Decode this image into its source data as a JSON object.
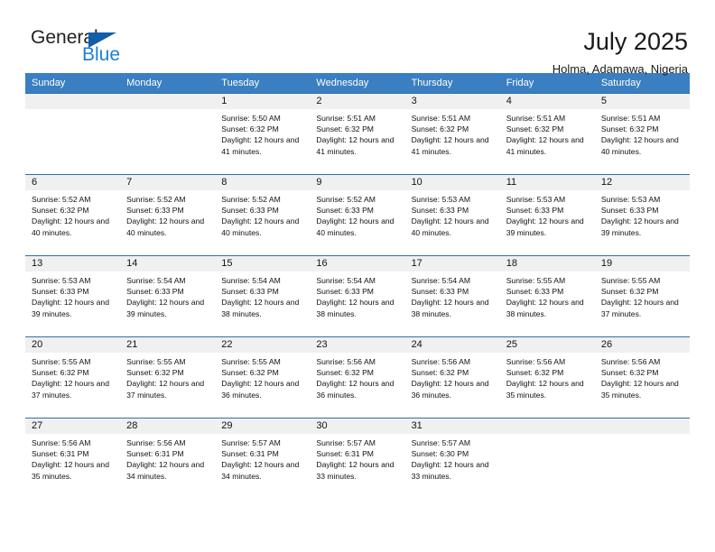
{
  "brand": {
    "name_top": "General",
    "name_bottom": "Blue",
    "triangle_color": "#125ea8",
    "blue_color": "#1c7fd4"
  },
  "header": {
    "title": "July 2025",
    "subtitle": "Holma, Adamawa, Nigeria"
  },
  "theme": {
    "header_row_bg": "#3a7fc1",
    "daynum_bg": "#f0f0f0",
    "row_border": "#2f6fad"
  },
  "weekdays": [
    "Sunday",
    "Monday",
    "Tuesday",
    "Wednesday",
    "Thursday",
    "Friday",
    "Saturday"
  ],
  "weeks": [
    [
      {
        "day": "",
        "blank": true
      },
      {
        "day": "",
        "blank": true
      },
      {
        "day": "1",
        "sunrise": "Sunrise: 5:50 AM",
        "sunset": "Sunset: 6:32 PM",
        "daylight": "Daylight: 12 hours and 41 minutes."
      },
      {
        "day": "2",
        "sunrise": "Sunrise: 5:51 AM",
        "sunset": "Sunset: 6:32 PM",
        "daylight": "Daylight: 12 hours and 41 minutes."
      },
      {
        "day": "3",
        "sunrise": "Sunrise: 5:51 AM",
        "sunset": "Sunset: 6:32 PM",
        "daylight": "Daylight: 12 hours and 41 minutes."
      },
      {
        "day": "4",
        "sunrise": "Sunrise: 5:51 AM",
        "sunset": "Sunset: 6:32 PM",
        "daylight": "Daylight: 12 hours and 41 minutes."
      },
      {
        "day": "5",
        "sunrise": "Sunrise: 5:51 AM",
        "sunset": "Sunset: 6:32 PM",
        "daylight": "Daylight: 12 hours and 40 minutes."
      }
    ],
    [
      {
        "day": "6",
        "sunrise": "Sunrise: 5:52 AM",
        "sunset": "Sunset: 6:32 PM",
        "daylight": "Daylight: 12 hours and 40 minutes."
      },
      {
        "day": "7",
        "sunrise": "Sunrise: 5:52 AM",
        "sunset": "Sunset: 6:33 PM",
        "daylight": "Daylight: 12 hours and 40 minutes."
      },
      {
        "day": "8",
        "sunrise": "Sunrise: 5:52 AM",
        "sunset": "Sunset: 6:33 PM",
        "daylight": "Daylight: 12 hours and 40 minutes."
      },
      {
        "day": "9",
        "sunrise": "Sunrise: 5:52 AM",
        "sunset": "Sunset: 6:33 PM",
        "daylight": "Daylight: 12 hours and 40 minutes."
      },
      {
        "day": "10",
        "sunrise": "Sunrise: 5:53 AM",
        "sunset": "Sunset: 6:33 PM",
        "daylight": "Daylight: 12 hours and 40 minutes."
      },
      {
        "day": "11",
        "sunrise": "Sunrise: 5:53 AM",
        "sunset": "Sunset: 6:33 PM",
        "daylight": "Daylight: 12 hours and 39 minutes."
      },
      {
        "day": "12",
        "sunrise": "Sunrise: 5:53 AM",
        "sunset": "Sunset: 6:33 PM",
        "daylight": "Daylight: 12 hours and 39 minutes."
      }
    ],
    [
      {
        "day": "13",
        "sunrise": "Sunrise: 5:53 AM",
        "sunset": "Sunset: 6:33 PM",
        "daylight": "Daylight: 12 hours and 39 minutes."
      },
      {
        "day": "14",
        "sunrise": "Sunrise: 5:54 AM",
        "sunset": "Sunset: 6:33 PM",
        "daylight": "Daylight: 12 hours and 39 minutes."
      },
      {
        "day": "15",
        "sunrise": "Sunrise: 5:54 AM",
        "sunset": "Sunset: 6:33 PM",
        "daylight": "Daylight: 12 hours and 38 minutes."
      },
      {
        "day": "16",
        "sunrise": "Sunrise: 5:54 AM",
        "sunset": "Sunset: 6:33 PM",
        "daylight": "Daylight: 12 hours and 38 minutes."
      },
      {
        "day": "17",
        "sunrise": "Sunrise: 5:54 AM",
        "sunset": "Sunset: 6:33 PM",
        "daylight": "Daylight: 12 hours and 38 minutes."
      },
      {
        "day": "18",
        "sunrise": "Sunrise: 5:55 AM",
        "sunset": "Sunset: 6:33 PM",
        "daylight": "Daylight: 12 hours and 38 minutes."
      },
      {
        "day": "19",
        "sunrise": "Sunrise: 5:55 AM",
        "sunset": "Sunset: 6:32 PM",
        "daylight": "Daylight: 12 hours and 37 minutes."
      }
    ],
    [
      {
        "day": "20",
        "sunrise": "Sunrise: 5:55 AM",
        "sunset": "Sunset: 6:32 PM",
        "daylight": "Daylight: 12 hours and 37 minutes."
      },
      {
        "day": "21",
        "sunrise": "Sunrise: 5:55 AM",
        "sunset": "Sunset: 6:32 PM",
        "daylight": "Daylight: 12 hours and 37 minutes."
      },
      {
        "day": "22",
        "sunrise": "Sunrise: 5:55 AM",
        "sunset": "Sunset: 6:32 PM",
        "daylight": "Daylight: 12 hours and 36 minutes."
      },
      {
        "day": "23",
        "sunrise": "Sunrise: 5:56 AM",
        "sunset": "Sunset: 6:32 PM",
        "daylight": "Daylight: 12 hours and 36 minutes."
      },
      {
        "day": "24",
        "sunrise": "Sunrise: 5:56 AM",
        "sunset": "Sunset: 6:32 PM",
        "daylight": "Daylight: 12 hours and 36 minutes."
      },
      {
        "day": "25",
        "sunrise": "Sunrise: 5:56 AM",
        "sunset": "Sunset: 6:32 PM",
        "daylight": "Daylight: 12 hours and 35 minutes."
      },
      {
        "day": "26",
        "sunrise": "Sunrise: 5:56 AM",
        "sunset": "Sunset: 6:32 PM",
        "daylight": "Daylight: 12 hours and 35 minutes."
      }
    ],
    [
      {
        "day": "27",
        "sunrise": "Sunrise: 5:56 AM",
        "sunset": "Sunset: 6:31 PM",
        "daylight": "Daylight: 12 hours and 35 minutes."
      },
      {
        "day": "28",
        "sunrise": "Sunrise: 5:56 AM",
        "sunset": "Sunset: 6:31 PM",
        "daylight": "Daylight: 12 hours and 34 minutes."
      },
      {
        "day": "29",
        "sunrise": "Sunrise: 5:57 AM",
        "sunset": "Sunset: 6:31 PM",
        "daylight": "Daylight: 12 hours and 34 minutes."
      },
      {
        "day": "30",
        "sunrise": "Sunrise: 5:57 AM",
        "sunset": "Sunset: 6:31 PM",
        "daylight": "Daylight: 12 hours and 33 minutes."
      },
      {
        "day": "31",
        "sunrise": "Sunrise: 5:57 AM",
        "sunset": "Sunset: 6:30 PM",
        "daylight": "Daylight: 12 hours and 33 minutes."
      },
      {
        "day": "",
        "blank": true
      },
      {
        "day": "",
        "blank": true
      }
    ]
  ]
}
